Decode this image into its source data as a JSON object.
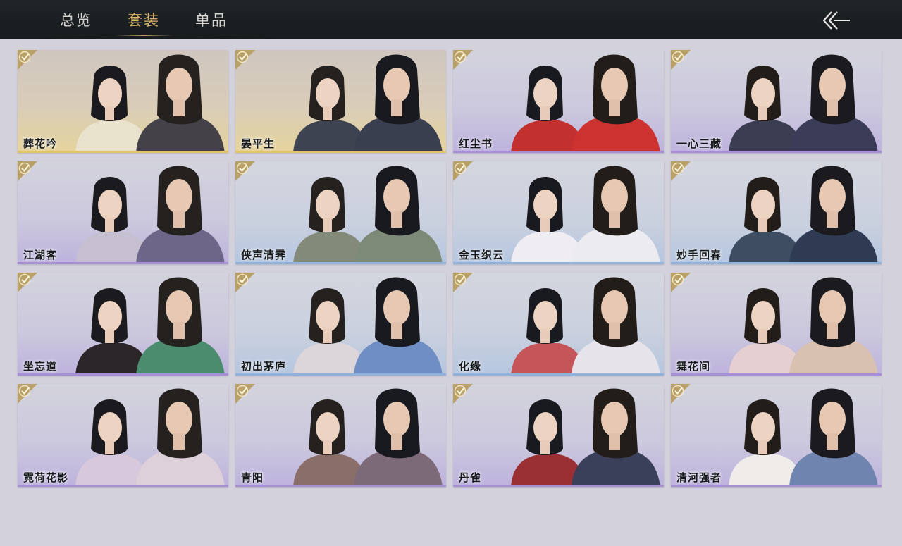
{
  "tabs": [
    {
      "label": "总览",
      "active": false
    },
    {
      "label": "套装",
      "active": true
    },
    {
      "label": "单品",
      "active": false
    }
  ],
  "back_icon": "double-chevron-left-icon",
  "colors": {
    "accent_gold": "#d9b46a",
    "topbar": "#1c2022",
    "page_bg": "#d2d1dc"
  },
  "outfits": [
    {
      "name": "葬花吟",
      "owned": true,
      "theme": "gold"
    },
    {
      "name": "晏平生",
      "owned": true,
      "theme": "gold"
    },
    {
      "name": "红尘书",
      "owned": true,
      "theme": "purple"
    },
    {
      "name": "一心三藏",
      "owned": true,
      "theme": "purple"
    },
    {
      "name": "江湖客",
      "owned": true,
      "theme": "purple"
    },
    {
      "name": "侠声清霁",
      "owned": true,
      "theme": "blue"
    },
    {
      "name": "金玉织云",
      "owned": true,
      "theme": "blue"
    },
    {
      "name": "妙手回春",
      "owned": true,
      "theme": "blue"
    },
    {
      "name": "坐忘道",
      "owned": true,
      "theme": "purple"
    },
    {
      "name": "初出茅庐",
      "owned": true,
      "theme": "blue"
    },
    {
      "name": "化缘",
      "owned": true,
      "theme": "blue"
    },
    {
      "name": "舞花间",
      "owned": true,
      "theme": "purple"
    },
    {
      "name": "霓荷花影",
      "owned": true,
      "theme": "purple"
    },
    {
      "name": "青阳",
      "owned": true,
      "theme": "purple"
    },
    {
      "name": "丹雀",
      "owned": true,
      "theme": "purple"
    },
    {
      "name": "清河强者",
      "owned": true,
      "theme": "purple"
    }
  ]
}
